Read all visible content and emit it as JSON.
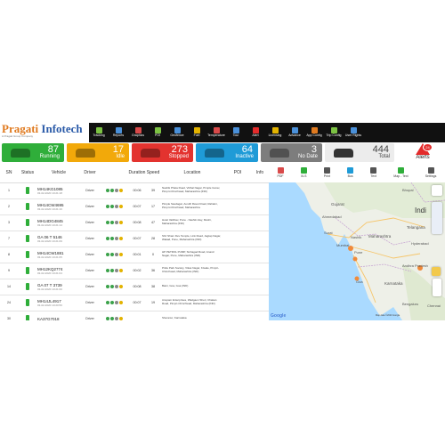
{
  "brand": {
    "name_part1": "Pragati",
    "name_part2": " Infotech",
    "tagline": "A Pragati Group Company"
  },
  "nav": [
    {
      "label": "Tracking",
      "icon": "tracking-icon",
      "color": "#7cc243"
    },
    {
      "label": "Reports",
      "icon": "reports-icon",
      "color": "#4a90d9"
    },
    {
      "label": "Graphics",
      "icon": "graphics-icon",
      "color": "#d94a4a"
    },
    {
      "label": "POI",
      "icon": "poi-icon",
      "color": "#7cc243"
    },
    {
      "label": "Geofence",
      "icon": "geofence-icon",
      "color": "#4a90d9"
    },
    {
      "label": "Fuel",
      "icon": "fuel-icon",
      "color": "#e3b300"
    },
    {
      "label": "Temperature",
      "icon": "temperature-icon",
      "color": "#d94a4a"
    },
    {
      "label": "Tour",
      "icon": "tour-icon",
      "color": "#4a90d9"
    },
    {
      "label": "Alert",
      "icon": "alert-icon",
      "color": "#e32b2b"
    },
    {
      "label": "Licensing",
      "icon": "licensing-icon",
      "color": "#e3b300"
    },
    {
      "label": "Advance",
      "icon": "advance-icon",
      "color": "#4a90d9"
    },
    {
      "label": "App Config",
      "icon": "app-config-icon",
      "color": "#e07a1f"
    },
    {
      "label": "Trip Config",
      "icon": "trip-config-icon",
      "color": "#7cc243"
    },
    {
      "label": "User Rights",
      "icon": "user-rights-icon",
      "color": "#4a90d9"
    }
  ],
  "cards": [
    {
      "label": "Running",
      "value": "87",
      "color": "#2fae3a"
    },
    {
      "label": "Idle",
      "value": "17",
      "color": "#f2a90a"
    },
    {
      "label": "Stopped",
      "value": "273",
      "color": "#e3332f"
    },
    {
      "label": "Inactive",
      "value": "64",
      "color": "#1f9bd7"
    },
    {
      "label": "No Date",
      "value": "3",
      "color": "#7d7d7d"
    },
    {
      "label": "Total",
      "value": "444",
      "color": "#ececec"
    }
  ],
  "alerts": {
    "label": "Alerts",
    "count": "24"
  },
  "table": {
    "headers": [
      "SN",
      "Status",
      "Vehicle",
      "Driver",
      "",
      "Duration",
      "Speed",
      "Location",
      "POI",
      "Info"
    ],
    "rows": [
      {
        "sn": "1",
        "vehicle": "MH14KG1085",
        "date": "03-02-2020 10:21:18",
        "driver": "Driver",
        "duration": "00:06",
        "speed": "39",
        "location": "Nashik Phata Road, Vitthal Nagar, Pimple Gurav, Pimpri-Chinchwad, Maharashtra (IND)"
      },
      {
        "sn": "2",
        "vehicle": "MH14CW4695",
        "date": "03-02-2020 10:21:16",
        "driver": "Driver",
        "duration": "00:07",
        "speed": "17",
        "location": "Pimple Saudagar, Aundh Ravet Road, Rahatni, Pimpri-Chinchwad, Maharashtra"
      },
      {
        "sn": "3",
        "vehicle": "MH14DG4845",
        "date": "03-02-2020 10:21:14",
        "driver": "Driver",
        "duration": "00:08",
        "speed": "47",
        "location": "Hotel Vaibhav, Pune - Nashik Hwy, Moshi, Maharashtra (IND)"
      },
      {
        "sn": "7",
        "vehicle": "GA 06 T 5146",
        "date": "03-02-2020 10:21:09",
        "driver": "Driver",
        "duration": "00:07",
        "speed": "28",
        "location": "Shri Sham Dev Temple, Link Road, Jagtap Nagar, Wakad, Pune, Maharashtra (IND)"
      },
      {
        "sn": "8",
        "vehicle": "MH14CW1881",
        "date": "03-02-2020 10:21:05",
        "driver": "Driver",
        "duration": "00:01",
        "speed": "0",
        "location": "HP PETROL PUMP, Sinhagad Road, Anand Nagar, Pune, Maharashtra (IND)"
      },
      {
        "sn": "9",
        "vehicle": "MH12KQ2774",
        "date": "03-02-2020 10:21:04",
        "driver": "Driver",
        "duration": "00:02",
        "speed": "36",
        "location": "Pride Park Society, Vikas Nagar, Kiwale, Pimpri-Chinchwad, Maharashtra (IND)"
      },
      {
        "sn": "14",
        "vehicle": "GA 07 T 3739",
        "date": "03-02-2020 10:21:00",
        "driver": "Driver",
        "duration": "00:08",
        "speed": "38",
        "location": "Baini, Goa, Goa (IND)"
      },
      {
        "sn": "24",
        "vehicle": "MH14JL4917",
        "date": "03-02-2020 10:20:56",
        "driver": "Driver",
        "duration": "00:07",
        "speed": "19",
        "location": "Anupam Enterprises, Wadgaon Sheri, Chakan Road, Pimpri-Chinchwad, Maharashtra (IND)"
      },
      {
        "sn": "30",
        "vehicle": "KA37G7018",
        "date": "",
        "driver": "Driver",
        "duration": "",
        "speed": "",
        "location": "Sheranur, Karnataka"
      }
    ]
  },
  "map_tools": [
    {
      "label": "PDF",
      "icon": "pdf-icon",
      "color": "#d94a4a"
    },
    {
      "label": "XLS",
      "icon": "xls-icon",
      "color": "#2fae3a"
    },
    {
      "label": "Print",
      "icon": "print-icon",
      "color": "#555555"
    },
    {
      "label": "Bus",
      "icon": "bus-icon",
      "color": "#1f9bd7"
    },
    {
      "label": "Text",
      "icon": "text-icon",
      "color": "#555555"
    },
    {
      "label": "Map - Text",
      "icon": "map-text-icon",
      "color": "#2fae3a"
    },
    {
      "label": "Settings",
      "icon": "settings-icon",
      "color": "#555555"
    }
  ],
  "map": {
    "labels": [
      "Gujarat",
      "Bhopal",
      "Ahmedabad",
      "Surat",
      "Nashik",
      "Mumbai",
      "Pune",
      "Goa",
      "Telangana",
      "Hyderabad",
      "Maharashtra",
      "Karnataka",
      "Andhra Pradesh",
      "Bengaluru",
      "Chennai",
      "Indi"
    ],
    "attribution": "Map data ©2020 Google"
  }
}
